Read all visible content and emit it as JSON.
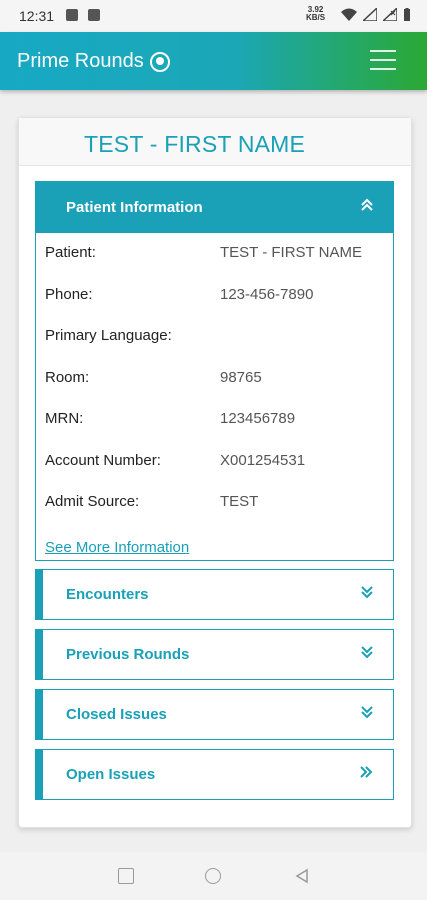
{
  "status_bar": {
    "time": "12:31",
    "network_speed": "3.92\nKB/S",
    "icons": [
      "notification-icon",
      "image-icon",
      "wifi-icon",
      "signal-icon",
      "signal-x-icon",
      "battery-icon"
    ]
  },
  "app_bar": {
    "title": "Prime Rounds",
    "logo": "prime-rounds-logo",
    "menu_icon": "hamburger-menu-icon"
  },
  "page": {
    "title": "TEST - FIRST NAME"
  },
  "patient_info": {
    "header": "Patient Information",
    "collapse_icon": "double-chevron-up-icon",
    "rows": [
      {
        "label": "Patient:",
        "value": "TEST - FIRST NAME"
      },
      {
        "label": "Phone:",
        "value": "123-456-7890"
      },
      {
        "label": "Primary Language:",
        "value": ""
      },
      {
        "label": "Room:",
        "value": "98765"
      },
      {
        "label": "MRN:",
        "value": "123456789"
      },
      {
        "label": "Account Number:",
        "value": "X001254531"
      },
      {
        "label": "Admit Source:",
        "value": "TEST"
      }
    ],
    "see_more": "See More Information"
  },
  "sections": [
    {
      "label": "Encounters",
      "icon": "double-chevron-down-icon",
      "glyph": "»"
    },
    {
      "label": "Previous Rounds",
      "icon": "double-chevron-down-icon",
      "glyph": "»"
    },
    {
      "label": "Closed Issues",
      "icon": "double-chevron-down-icon",
      "glyph": "»"
    },
    {
      "label": "Open Issues",
      "icon": "double-chevron-right-icon",
      "glyph": "»"
    }
  ],
  "colors": {
    "accent": "#1aa0b7",
    "appbar_gradient_start": "#17a9c4",
    "appbar_gradient_end": "#2ba834"
  }
}
